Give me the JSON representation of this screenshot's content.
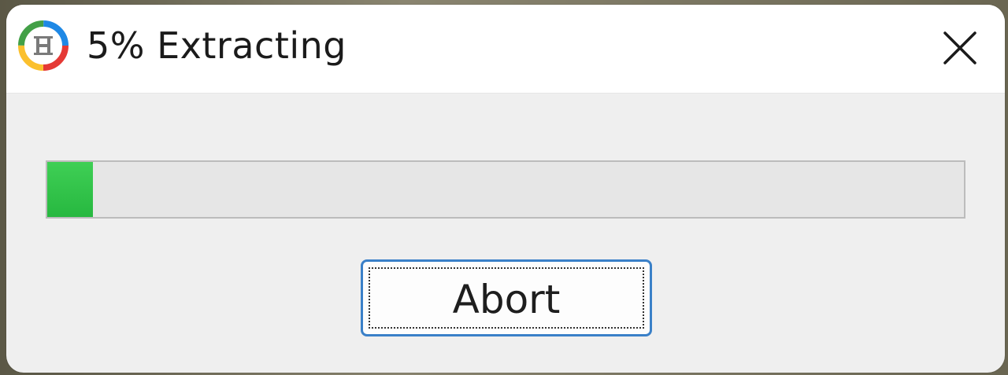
{
  "window": {
    "title": "5% Extracting",
    "app_icon": "circular-logo-icon",
    "close_icon": "close-icon"
  },
  "progress": {
    "percent": 5,
    "fill_color": "#2fc246"
  },
  "actions": {
    "abort_label": "Abort"
  }
}
